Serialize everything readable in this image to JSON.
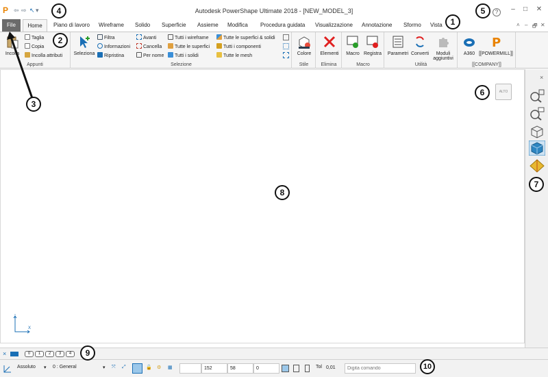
{
  "window": {
    "title": "Autodesk PowerShape Ultimate 2018 - [NEW_MODEL_3]",
    "help_glyph": "?",
    "minimize": "–",
    "maximize": "□",
    "close": "✕"
  },
  "quick_access": {
    "undo": "⇦",
    "redo": "⇨",
    "select": "↖",
    "more": "▾"
  },
  "tabs": {
    "file": "File",
    "items": [
      "Home",
      "Piano di lavoro",
      "Wireframe",
      "Solido",
      "Superficie",
      "Assieme",
      "Modifica",
      "Procedura guidata",
      "Visualizzazione",
      "Annotazione",
      "Sformo",
      "Vista"
    ],
    "collapse": "˄",
    "min_doc": "–",
    "restore_doc": "🗗",
    "close_doc": "✕"
  },
  "ribbon": {
    "appunti": {
      "label": "Appunti",
      "incolla": "Incolla",
      "taglia": "Taglia",
      "copia": "Copia",
      "incolla_attributi": "Incolla attributi"
    },
    "selezione": {
      "label": "Selezione",
      "seleziona": "Seleziona",
      "filtra": "Filtra",
      "informazioni": "Informazioni",
      "ripristina": "Ripristina",
      "avanti": "Avanti",
      "cancella": "Cancella",
      "per_nome": "Per nome",
      "tutti_wireframe": "Tutti i wireframe",
      "tutte_superfici": "Tutte le superfici",
      "tutti_solidi": "Tutti i solidi",
      "tutte_superfici_solidi": "Tutte le superfici & solidi",
      "tutti_componenti": "Tutti i componenti",
      "tutte_mesh": "Tutte le mesh"
    },
    "stile": {
      "label": "Stile",
      "colore": "Colore"
    },
    "elimina": {
      "label": "Elimina",
      "elementi": "Elementi"
    },
    "macro": {
      "label": "Macro",
      "macro": "Macro",
      "registra": "Registra"
    },
    "utilita": {
      "label": "Utilità",
      "parametri": "Parametri",
      "converti": "Converti",
      "moduli": "Moduli",
      "aggiuntivi": "aggiuntivi"
    },
    "company": {
      "label": "[[COMPANY]]",
      "a360": "A360",
      "powermill": "[[POWERMILL]]"
    }
  },
  "viewport": {
    "view_cube_label": "ALTO",
    "axis_x": "X",
    "axis_y": "Y"
  },
  "sidebar": {
    "close": "×"
  },
  "levels": [
    "0",
    "1",
    "2",
    "3",
    "4"
  ],
  "status": {
    "mode": "Assoluto",
    "workplane": "0 : General",
    "x": "152",
    "y": "58",
    "z": "0",
    "tol_label": "Tol",
    "tol_value": "0,01",
    "command_placeholder": "Digita comando"
  },
  "callouts": [
    "1",
    "2",
    "3",
    "4",
    "5",
    "6",
    "7",
    "8",
    "9",
    "10"
  ],
  "colors": {
    "file_tab": "#6b6b6b",
    "logo": "#e98300",
    "ribbon_bg": "#f5f5f5",
    "sidebar_active": "#2e86c1"
  }
}
